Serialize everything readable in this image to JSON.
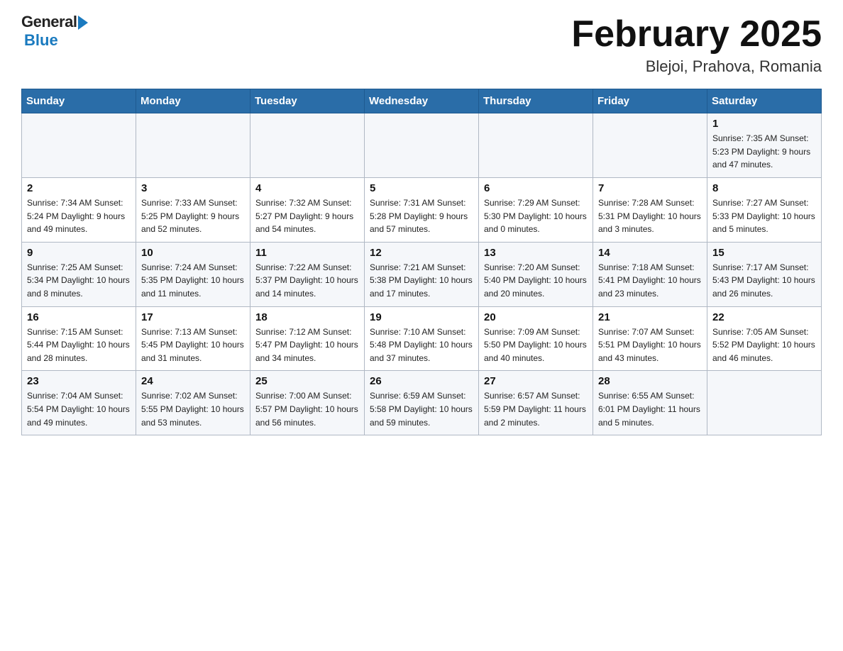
{
  "header": {
    "logo_general": "General",
    "logo_blue": "Blue",
    "title": "February 2025",
    "subtitle": "Blejoi, Prahova, Romania"
  },
  "weekdays": [
    "Sunday",
    "Monday",
    "Tuesday",
    "Wednesday",
    "Thursday",
    "Friday",
    "Saturday"
  ],
  "weeks": [
    {
      "days": [
        {
          "num": "",
          "info": ""
        },
        {
          "num": "",
          "info": ""
        },
        {
          "num": "",
          "info": ""
        },
        {
          "num": "",
          "info": ""
        },
        {
          "num": "",
          "info": ""
        },
        {
          "num": "",
          "info": ""
        },
        {
          "num": "1",
          "info": "Sunrise: 7:35 AM\nSunset: 5:23 PM\nDaylight: 9 hours\nand 47 minutes."
        }
      ]
    },
    {
      "days": [
        {
          "num": "2",
          "info": "Sunrise: 7:34 AM\nSunset: 5:24 PM\nDaylight: 9 hours\nand 49 minutes."
        },
        {
          "num": "3",
          "info": "Sunrise: 7:33 AM\nSunset: 5:25 PM\nDaylight: 9 hours\nand 52 minutes."
        },
        {
          "num": "4",
          "info": "Sunrise: 7:32 AM\nSunset: 5:27 PM\nDaylight: 9 hours\nand 54 minutes."
        },
        {
          "num": "5",
          "info": "Sunrise: 7:31 AM\nSunset: 5:28 PM\nDaylight: 9 hours\nand 57 minutes."
        },
        {
          "num": "6",
          "info": "Sunrise: 7:29 AM\nSunset: 5:30 PM\nDaylight: 10 hours\nand 0 minutes."
        },
        {
          "num": "7",
          "info": "Sunrise: 7:28 AM\nSunset: 5:31 PM\nDaylight: 10 hours\nand 3 minutes."
        },
        {
          "num": "8",
          "info": "Sunrise: 7:27 AM\nSunset: 5:33 PM\nDaylight: 10 hours\nand 5 minutes."
        }
      ]
    },
    {
      "days": [
        {
          "num": "9",
          "info": "Sunrise: 7:25 AM\nSunset: 5:34 PM\nDaylight: 10 hours\nand 8 minutes."
        },
        {
          "num": "10",
          "info": "Sunrise: 7:24 AM\nSunset: 5:35 PM\nDaylight: 10 hours\nand 11 minutes."
        },
        {
          "num": "11",
          "info": "Sunrise: 7:22 AM\nSunset: 5:37 PM\nDaylight: 10 hours\nand 14 minutes."
        },
        {
          "num": "12",
          "info": "Sunrise: 7:21 AM\nSunset: 5:38 PM\nDaylight: 10 hours\nand 17 minutes."
        },
        {
          "num": "13",
          "info": "Sunrise: 7:20 AM\nSunset: 5:40 PM\nDaylight: 10 hours\nand 20 minutes."
        },
        {
          "num": "14",
          "info": "Sunrise: 7:18 AM\nSunset: 5:41 PM\nDaylight: 10 hours\nand 23 minutes."
        },
        {
          "num": "15",
          "info": "Sunrise: 7:17 AM\nSunset: 5:43 PM\nDaylight: 10 hours\nand 26 minutes."
        }
      ]
    },
    {
      "days": [
        {
          "num": "16",
          "info": "Sunrise: 7:15 AM\nSunset: 5:44 PM\nDaylight: 10 hours\nand 28 minutes."
        },
        {
          "num": "17",
          "info": "Sunrise: 7:13 AM\nSunset: 5:45 PM\nDaylight: 10 hours\nand 31 minutes."
        },
        {
          "num": "18",
          "info": "Sunrise: 7:12 AM\nSunset: 5:47 PM\nDaylight: 10 hours\nand 34 minutes."
        },
        {
          "num": "19",
          "info": "Sunrise: 7:10 AM\nSunset: 5:48 PM\nDaylight: 10 hours\nand 37 minutes."
        },
        {
          "num": "20",
          "info": "Sunrise: 7:09 AM\nSunset: 5:50 PM\nDaylight: 10 hours\nand 40 minutes."
        },
        {
          "num": "21",
          "info": "Sunrise: 7:07 AM\nSunset: 5:51 PM\nDaylight: 10 hours\nand 43 minutes."
        },
        {
          "num": "22",
          "info": "Sunrise: 7:05 AM\nSunset: 5:52 PM\nDaylight: 10 hours\nand 46 minutes."
        }
      ]
    },
    {
      "days": [
        {
          "num": "23",
          "info": "Sunrise: 7:04 AM\nSunset: 5:54 PM\nDaylight: 10 hours\nand 49 minutes."
        },
        {
          "num": "24",
          "info": "Sunrise: 7:02 AM\nSunset: 5:55 PM\nDaylight: 10 hours\nand 53 minutes."
        },
        {
          "num": "25",
          "info": "Sunrise: 7:00 AM\nSunset: 5:57 PM\nDaylight: 10 hours\nand 56 minutes."
        },
        {
          "num": "26",
          "info": "Sunrise: 6:59 AM\nSunset: 5:58 PM\nDaylight: 10 hours\nand 59 minutes."
        },
        {
          "num": "27",
          "info": "Sunrise: 6:57 AM\nSunset: 5:59 PM\nDaylight: 11 hours\nand 2 minutes."
        },
        {
          "num": "28",
          "info": "Sunrise: 6:55 AM\nSunset: 6:01 PM\nDaylight: 11 hours\nand 5 minutes."
        },
        {
          "num": "",
          "info": ""
        }
      ]
    }
  ]
}
